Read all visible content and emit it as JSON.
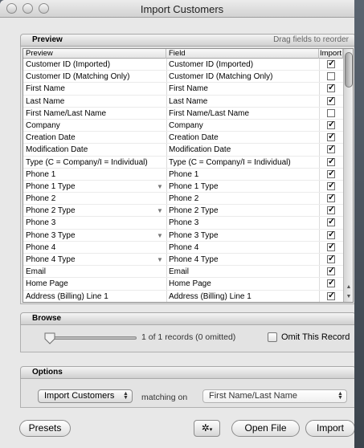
{
  "window": {
    "title": "Import Customers"
  },
  "preview": {
    "header": "Preview",
    "hint": "Drag fields to reorder",
    "columns": {
      "source": "Preview",
      "field": "Field",
      "import": "Import"
    },
    "rows": [
      {
        "source": "Customer ID (Imported)",
        "field": "Customer ID (Imported)",
        "checked": true,
        "has_menu": false
      },
      {
        "source": "Customer ID (Matching Only)",
        "field": "Customer ID (Matching Only)",
        "checked": false,
        "has_menu": false
      },
      {
        "source": "First Name",
        "field": "First Name",
        "checked": true,
        "has_menu": false
      },
      {
        "source": "Last Name",
        "field": "Last Name",
        "checked": true,
        "has_menu": false
      },
      {
        "source": "First Name/Last Name",
        "field": "First Name/Last Name",
        "checked": false,
        "has_menu": false
      },
      {
        "source": "Company",
        "field": "Company",
        "checked": true,
        "has_menu": false
      },
      {
        "source": "Creation Date",
        "field": "Creation Date",
        "checked": true,
        "has_menu": false
      },
      {
        "source": "Modification Date",
        "field": "Modification Date",
        "checked": true,
        "has_menu": false
      },
      {
        "source": "Type (C = Company/I = Individual)",
        "field": "Type (C = Company/I = Individual)",
        "checked": true,
        "has_menu": false
      },
      {
        "source": "Phone 1",
        "field": "Phone 1",
        "checked": true,
        "has_menu": false
      },
      {
        "source": "Phone 1 Type",
        "field": "Phone 1 Type",
        "checked": true,
        "has_menu": true
      },
      {
        "source": "Phone 2",
        "field": "Phone 2",
        "checked": true,
        "has_menu": false
      },
      {
        "source": "Phone 2 Type",
        "field": "Phone 2 Type",
        "checked": true,
        "has_menu": true
      },
      {
        "source": "Phone 3",
        "field": "Phone 3",
        "checked": true,
        "has_menu": false
      },
      {
        "source": "Phone 3 Type",
        "field": "Phone 3 Type",
        "checked": true,
        "has_menu": true
      },
      {
        "source": "Phone 4",
        "field": "Phone 4",
        "checked": true,
        "has_menu": false
      },
      {
        "source": "Phone 4 Type",
        "field": "Phone 4 Type",
        "checked": true,
        "has_menu": true
      },
      {
        "source": "Email",
        "field": "Email",
        "checked": true,
        "has_menu": false
      },
      {
        "source": "Home Page",
        "field": "Home Page",
        "checked": true,
        "has_menu": false
      },
      {
        "source": "Address (Billing) Line 1",
        "field": "Address (Billing) Line 1",
        "checked": true,
        "has_menu": false
      }
    ]
  },
  "browse": {
    "header": "Browse",
    "records_text": "1 of 1 records (0 omitted)",
    "omit_label": "Omit This Record",
    "omit_checked": false
  },
  "options": {
    "header": "Options",
    "mode_value": "Import Customers",
    "matching_label": "matching on",
    "match_field_value": "First Name/Last Name"
  },
  "buttons": {
    "presets": "Presets",
    "open_file": "Open File",
    "import": "Import"
  }
}
